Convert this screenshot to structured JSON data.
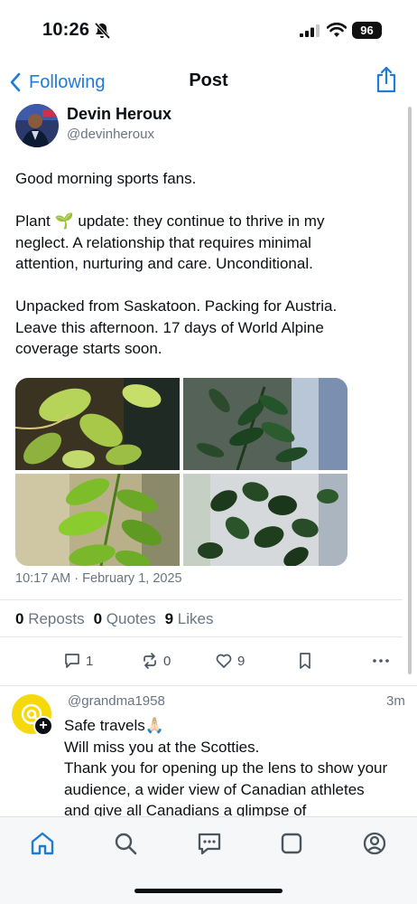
{
  "status_bar": {
    "time": "10:26",
    "battery": "96"
  },
  "nav": {
    "back_label": "Following",
    "title": "Post"
  },
  "post": {
    "author_name": "Devin Heroux",
    "author_handle": "@devinheroux",
    "paragraphs": [
      "Good morning sports fans.",
      "Plant 🌱 update: they continue to thrive in my neglect. A relationship that requires minimal attention, nurturing and care. Unconditional.",
      "Unpacked from Saskatoon. Packing for Austria. Leave this afternoon. 17 days of World Alpine coverage starts soon."
    ],
    "timestamp": "10:17 AM · February 1, 2025",
    "stats": {
      "reposts_count": "0",
      "reposts_label": "Reposts",
      "quotes_count": "0",
      "quotes_label": "Quotes",
      "likes_count": "9",
      "likes_label": "Likes"
    },
    "actions": {
      "replies": "1",
      "reposts": "0",
      "likes": "9"
    }
  },
  "reply": {
    "handle": "@grandma1958",
    "time": "3m",
    "lines": [
      "Safe travels🙏🏻",
      "Will miss you at the Scotties.",
      "Thank you for opening up the lens to show your audience, a wider view of Canadian athletes and give all Canadians a glimpse of"
    ]
  },
  "colors": {
    "accent": "#1f7ad8",
    "muted": "#6b7580",
    "avatar_yellow": "#f5d90a"
  },
  "icons": [
    "bell-slash-icon",
    "signal-icon",
    "wifi-icon",
    "back-chevron-icon",
    "share-icon",
    "reply-icon",
    "repost-icon",
    "like-icon",
    "bookmark-icon",
    "more-icon",
    "home-icon",
    "search-icon",
    "messages-icon",
    "feeds-icon",
    "profile-icon"
  ]
}
